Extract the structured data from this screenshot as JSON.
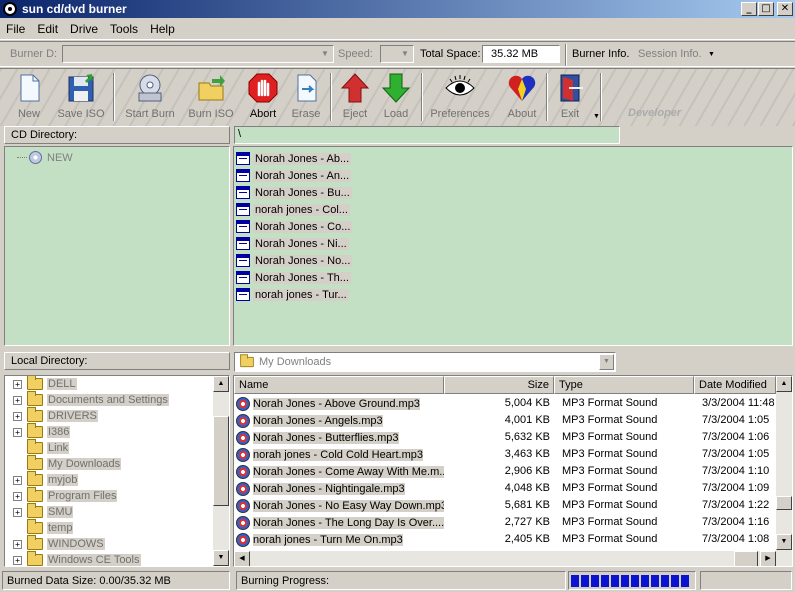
{
  "window": {
    "title": "sun cd/dvd burner",
    "controls": {
      "minimize": "_",
      "maximize": "□",
      "close": "✕"
    }
  },
  "menu": {
    "items": [
      "File",
      "Edit",
      "Drive",
      "Tools",
      "Help"
    ]
  },
  "burner_bar": {
    "burner_label": "Burner D:",
    "burner_value": "",
    "speed_label": "Speed:",
    "speed_value": "",
    "total_space_label": "Total Space:",
    "total_space_value": "35.32 MB",
    "burner_info_label": "Burner Info.",
    "session_info_label": "Session Info."
  },
  "toolbar": {
    "buttons": [
      {
        "label": "New",
        "icon": "new-document-icon",
        "enabled": false
      },
      {
        "label": "Save ISO",
        "icon": "floppy-disk-icon",
        "enabled": false
      },
      {
        "label": "Start Burn",
        "icon": "cd-drive-icon",
        "enabled": false
      },
      {
        "label": "Burn ISO",
        "icon": "folder-arrow-icon",
        "enabled": false
      },
      {
        "label": "Abort",
        "icon": "stop-hand-icon",
        "enabled": true
      },
      {
        "label": "Erase",
        "icon": "erase-document-icon",
        "enabled": false
      },
      {
        "label": "Eject",
        "icon": "arrow-up-icon",
        "enabled": false
      },
      {
        "label": "Load",
        "icon": "arrow-down-icon",
        "enabled": false
      },
      {
        "label": "Preferences",
        "icon": "eye-icon",
        "enabled": false
      },
      {
        "label": "About",
        "icon": "colorful-heart-icon",
        "enabled": false
      },
      {
        "label": "Exit",
        "icon": "exit-door-icon",
        "enabled": false
      }
    ],
    "watermark": "Developer"
  },
  "cd_directory": {
    "label": "CD Directory:",
    "path": "\\",
    "tree_root": "NEW",
    "files": [
      "Norah Jones - Ab...",
      "Norah Jones - An...",
      "Norah Jones - Bu...",
      "norah jones - Col...",
      "Norah Jones - Co...",
      "Norah Jones - Ni...",
      "Norah Jones - No...",
      "Norah Jones - Th...",
      "norah jones - Tur..."
    ]
  },
  "local_directory": {
    "label": "Local Directory:",
    "current_folder": "My Downloads",
    "tree": [
      {
        "name": "DELL",
        "expandable": true
      },
      {
        "name": "Documents and Settings",
        "expandable": true
      },
      {
        "name": "DRIVERS",
        "expandable": true
      },
      {
        "name": "I386",
        "expandable": true
      },
      {
        "name": "Link",
        "expandable": false
      },
      {
        "name": "My Downloads",
        "expandable": false
      },
      {
        "name": "myjob",
        "expandable": true
      },
      {
        "name": "Program Files",
        "expandable": true
      },
      {
        "name": "SMU",
        "expandable": true
      },
      {
        "name": "temp",
        "expandable": false
      },
      {
        "name": "WINDOWS",
        "expandable": true
      },
      {
        "name": "Windows CE Tools",
        "expandable": true
      }
    ],
    "columns": [
      "Name",
      "Size",
      "Type",
      "Date Modified"
    ],
    "files": [
      {
        "name": "Norah Jones - Above Ground.mp3",
        "size": "5,004 KB",
        "type": "MP3 Format Sound",
        "date": "3/3/2004 11:48"
      },
      {
        "name": "Norah Jones - Angels.mp3",
        "size": "4,001 KB",
        "type": "MP3 Format Sound",
        "date": "7/3/2004 1:05"
      },
      {
        "name": "Norah Jones - Butterflies.mp3",
        "size": "5,632 KB",
        "type": "MP3 Format Sound",
        "date": "7/3/2004 1:06"
      },
      {
        "name": "norah jones - Cold Cold Heart.mp3",
        "size": "3,463 KB",
        "type": "MP3 Format Sound",
        "date": "7/3/2004 1:05"
      },
      {
        "name": "Norah Jones - Come Away With Me.m...",
        "size": "2,906 KB",
        "type": "MP3 Format Sound",
        "date": "7/3/2004 1:10"
      },
      {
        "name": "Norah Jones - Nightingale.mp3",
        "size": "4,048 KB",
        "type": "MP3 Format Sound",
        "date": "7/3/2004 1:09"
      },
      {
        "name": "Norah Jones - No Easy Way Down.mp3",
        "size": "5,681 KB",
        "type": "MP3 Format Sound",
        "date": "7/3/2004 1:22"
      },
      {
        "name": "Norah Jones - The Long Day Is Over....",
        "size": "2,727 KB",
        "type": "MP3 Format Sound",
        "date": "7/3/2004 1:16"
      },
      {
        "name": "norah jones - Turn Me On.mp3",
        "size": "2,405 KB",
        "type": "MP3 Format Sound",
        "date": "7/3/2004 1:08"
      }
    ]
  },
  "status": {
    "burned_label": "Burned Data Size: 0.00/35.32 MB",
    "progress_label": "Burning Progress:",
    "progress_fraction": 0.97
  },
  "colors": {
    "title_gradient_start": "#0a246a",
    "panel_green": "#c3dfc4",
    "progress_blue": "#0a14d0",
    "abort_red": "#e02020"
  }
}
